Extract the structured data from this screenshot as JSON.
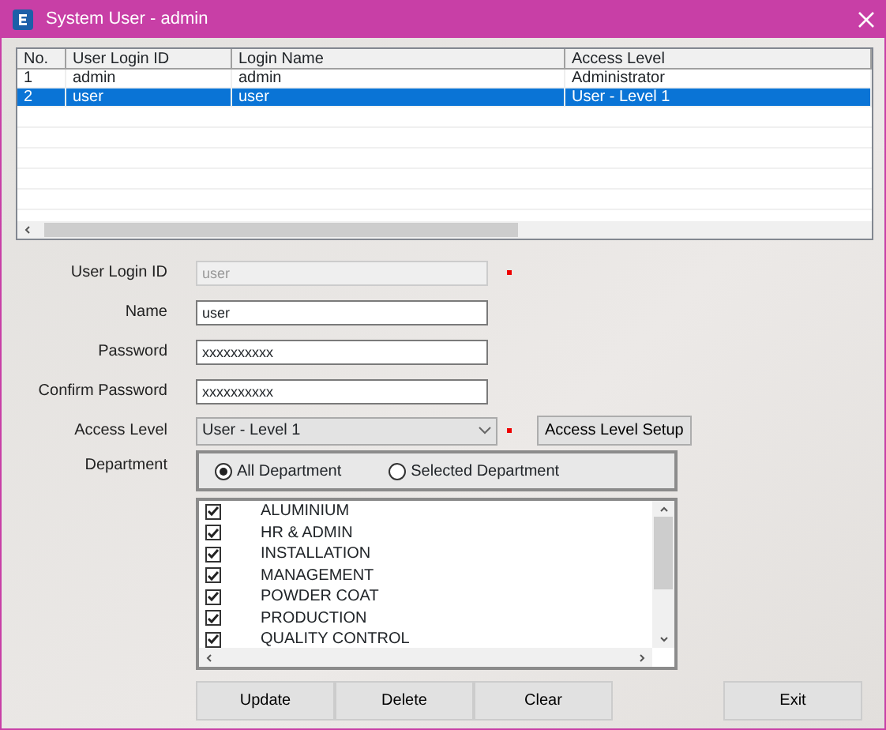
{
  "window": {
    "title": "System User - admin"
  },
  "table": {
    "columns": [
      "No.",
      "User Login ID",
      "Login Name",
      "Access Level"
    ],
    "rows": [
      {
        "cells": [
          "1",
          "admin",
          "admin",
          "Administrator"
        ],
        "selected": false
      },
      {
        "cells": [
          "2",
          "user",
          "user",
          "User - Level 1"
        ],
        "selected": true
      }
    ]
  },
  "form": {
    "fields": [
      {
        "label": "User Login ID",
        "kind": "text",
        "value": "user",
        "disabled": true,
        "required": true
      },
      {
        "label": "Name",
        "kind": "text",
        "value": "user",
        "disabled": false,
        "required": false
      },
      {
        "label": "Password",
        "kind": "text",
        "value": "xxxxxxxxxx",
        "disabled": false,
        "required": false
      },
      {
        "label": "Confirm Password",
        "kind": "text",
        "value": "xxxxxxxxxx",
        "disabled": false,
        "required": false
      },
      {
        "label": "Access Level",
        "kind": "select",
        "value": "User - Level 1",
        "disabled": false,
        "required": true,
        "button": "Access Level Setup"
      }
    ],
    "department": {
      "label": "Department",
      "options": [
        {
          "label": "All Department",
          "selected": true
        },
        {
          "label": "Selected Department",
          "selected": false
        }
      ],
      "items": [
        {
          "label": "ALUMINIUM",
          "checked": true
        },
        {
          "label": "HR & ADMIN",
          "checked": true
        },
        {
          "label": "INSTALLATION",
          "checked": true
        },
        {
          "label": "MANAGEMENT",
          "checked": true
        },
        {
          "label": "POWDER COAT",
          "checked": true
        },
        {
          "label": "PRODUCTION",
          "checked": true
        },
        {
          "label": "QUALITY CONTROL",
          "checked": true
        }
      ]
    }
  },
  "buttons": [
    "Update",
    "Delete",
    "Clear",
    "Exit"
  ]
}
